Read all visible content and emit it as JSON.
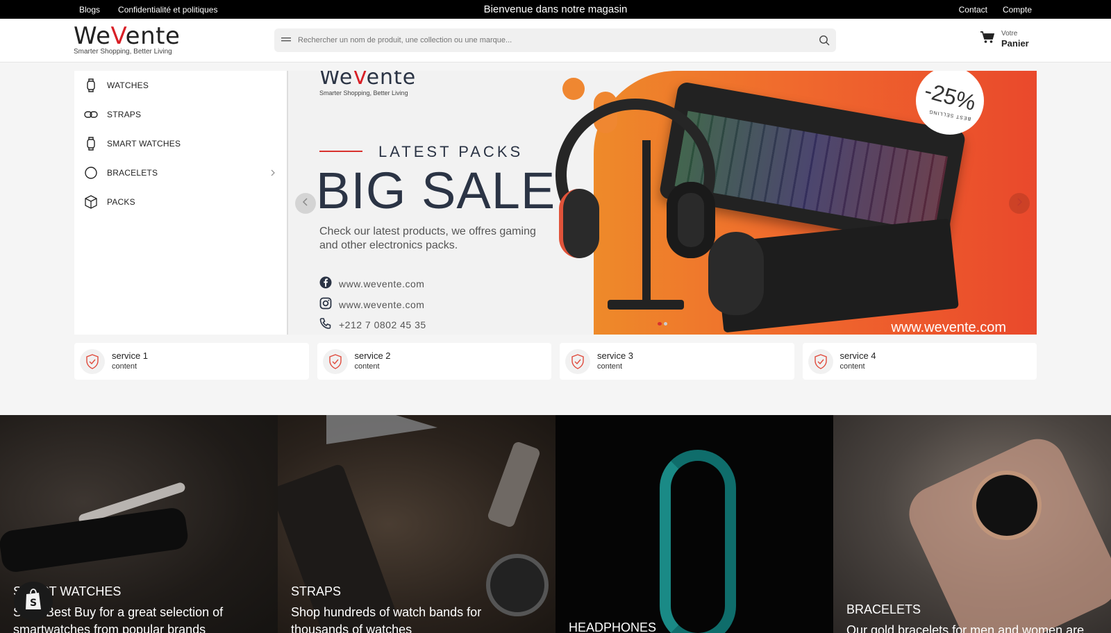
{
  "topbar": {
    "links_left": [
      "Blogs",
      "Confidentialité et politiques"
    ],
    "welcome": "Bienvenue dans notre magasin",
    "links_right": [
      "Contact",
      "Compte"
    ]
  },
  "header": {
    "logo_text_a": "We",
    "logo_text_v": "V",
    "logo_text_b": "ente",
    "logo_tagline": "Smarter Shopping, Better Living",
    "search_placeholder": "Rechercher un nom de produit, une collection ou une marque...",
    "cart_small": "Votre",
    "cart_big": "Panier"
  },
  "categories": [
    {
      "label": "WATCHES",
      "icon": "watch-icon"
    },
    {
      "label": "STRAPS",
      "icon": "link-icon"
    },
    {
      "label": "SMART WATCHES",
      "icon": "smartwatch-icon"
    },
    {
      "label": "BRACELETS",
      "icon": "circle-icon",
      "has_submenu": true
    },
    {
      "label": "PACKS",
      "icon": "box-icon"
    }
  ],
  "banner": {
    "brand_a": "We",
    "brand_v": "V",
    "brand_b": "ente",
    "brand_tagline": "Smarter Shopping, Better Living",
    "kicker": "LATEST PACKS",
    "headline": "BIG SALE",
    "description": "Check our latest products, we offres gaming and other electronics packs.",
    "facebook": "www.wevente.com",
    "instagram": "www.wevente.com",
    "phone": "+212 7 0802 45 35",
    "discount": "-25%",
    "badge_text": "BEST SELLING",
    "footer_url": "www.wevente.com",
    "slide_count": 2,
    "active_slide": 1
  },
  "services": [
    {
      "title": "service 1",
      "content": "content"
    },
    {
      "title": "service 2",
      "content": "content"
    },
    {
      "title": "service 3",
      "content": "content"
    },
    {
      "title": "service 4",
      "content": "content"
    }
  ],
  "tiles": [
    {
      "title": "SMART WATCHES",
      "subtitle": "Shop Best Buy for a great selection of smartwatches from popular brands"
    },
    {
      "title": "STRAPS",
      "subtitle": "Shop hundreds of watch bands for thousands of watches"
    },
    {
      "title": "HEADPHONES",
      "subtitle": ""
    },
    {
      "title": "BRACELETS",
      "subtitle": "Our gold bracelets for men and women are"
    }
  ],
  "colors": {
    "accent": "#d81f26",
    "topbar_bg": "#000000",
    "banner_orange": "#f06a2d"
  }
}
